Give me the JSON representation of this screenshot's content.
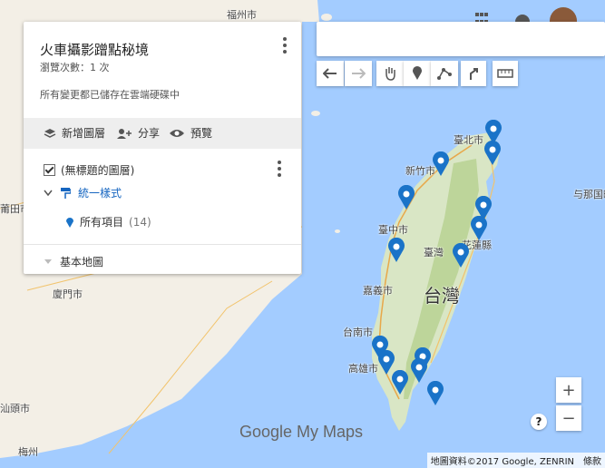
{
  "panel": {
    "title": "火車攝影蹭點秘境",
    "views": "瀏覽次數：1 次",
    "saved": "所有變更都已儲存在雲端硬碟中",
    "add_layer": "新增圖層",
    "share": "分享",
    "preview": "預覽",
    "layer_name": "(無標題的圖層)",
    "style": "統一樣式",
    "all_items": "所有項目",
    "item_count": "(14)",
    "basemap": "基本地圖"
  },
  "map": {
    "labels": {
      "taipei": "臺北市",
      "hsinchu": "新竹市",
      "taichung": "臺中市",
      "hualien": "花蓮縣",
      "taiwan_small": "臺灣",
      "taiwan_big": "台灣",
      "chiayi": "嘉義市",
      "tainan": "台南市",
      "kaohsiung": "高雄市",
      "fuzhou": "福州市",
      "putian": "莆田市",
      "xiamen": "廈門市",
      "shantou": "汕頭市",
      "meizhou": "梅州",
      "yonaguni": "与那国町"
    },
    "zoom_in": "+",
    "zoom_out": "−",
    "help": "?",
    "brand": "Google My Maps",
    "attribution": "地圖資料©2017 Google, ZENRIN",
    "terms": "條款",
    "pin_color": "#1a73c8",
    "land_color": "#f3efe6",
    "sea_color": "#a3ccff",
    "mountain_color": "#c9dba6"
  }
}
